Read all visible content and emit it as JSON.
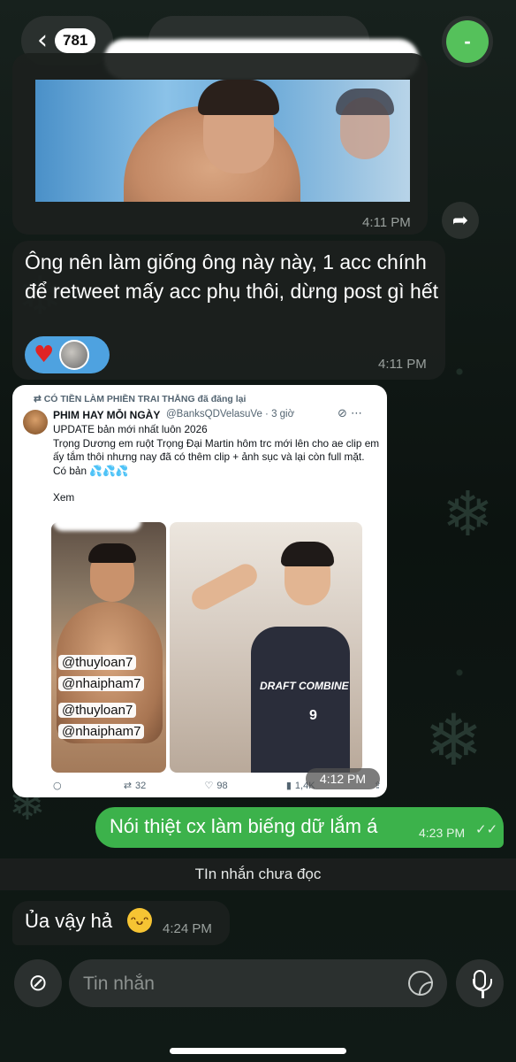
{
  "header": {
    "back_count": "781",
    "avatar_initial": "-"
  },
  "messages": {
    "m1": {
      "time": "4:11 PM"
    },
    "m2": {
      "text": "Ông nên làm giống ông này này, 1 acc chính để retweet mấy acc phụ thôi, dừng post gì hết",
      "time": "4:11 PM",
      "reaction": "heart"
    },
    "tweet": {
      "retweet_line": "CÓ TIỀN LÀM PHIỀN TRAI THẲNG đã đăng lại",
      "name": "PHIM HAY MỖI NGÀY",
      "handle": "@BanksQDVelasuVe · 3 giờ",
      "text_line1": "UPDATE bản mới nhất luôn 2026",
      "text_line2": "Trọng Dương em ruột Trọng Đại Martin hôm trc mới lên cho ae clip em ấy tắm thôi nhưng nay đã có thêm clip + ảnh sục và lại còn full mặt.",
      "text_line3": "Có bản",
      "text_line4": "Xem",
      "watermark_1": "@thuyloan7",
      "watermark_2": "@nhaipham7",
      "watermark_3": "@thuyloan7",
      "watermark_4": "@nhaipham7",
      "jersey_text": "DRAFT COMBINE",
      "jersey_number": "9",
      "replies": "",
      "retweets": "32",
      "likes": "98",
      "views": "1,4K",
      "time": "4:12 PM"
    },
    "out": {
      "text": "Nói thiệt cx làm biếng dữ lắm á",
      "time": "4:23 PM"
    },
    "unread_label": "TIn nhắn chưa đọc",
    "m3": {
      "text": "Ủa vậy hả",
      "time": "4:24 PM"
    }
  },
  "composer": {
    "placeholder": "Tin nhắn"
  },
  "colors": {
    "outgoing": "#3cb24b",
    "reaction": "#4ea2e0",
    "avatar": "#55c15b"
  }
}
